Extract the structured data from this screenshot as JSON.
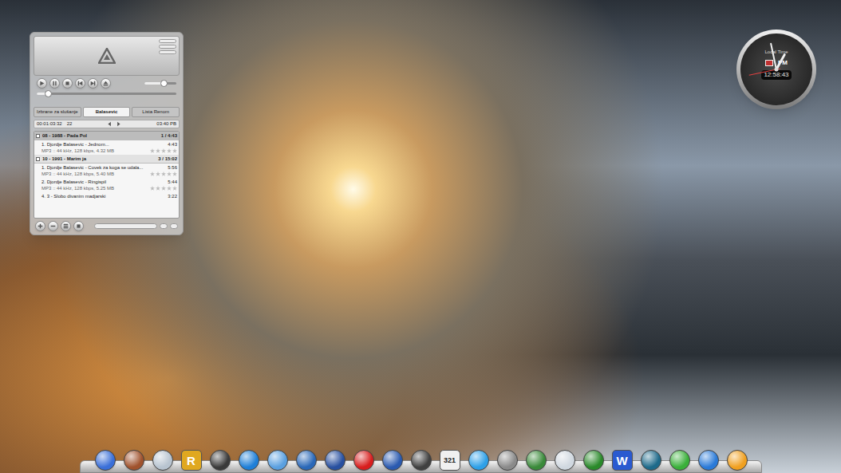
{
  "player": {
    "progress": {
      "level": 0.08
    },
    "volume": {
      "level": 0.6
    },
    "tabs": [
      {
        "label": "Izbrane za slušanje",
        "selected": false
      },
      {
        "label": "Balasevic",
        "selected": true
      },
      {
        "label": "Lista Renom",
        "selected": false
      }
    ],
    "info": {
      "elapsed": "00:01:03:32",
      "count": "22",
      "total": "03:40 PB"
    },
    "playlist": [
      {
        "kind": "group",
        "title": "08 - 1988 - Pada Pol",
        "summary": "1 / 4:43",
        "selected": true
      },
      {
        "kind": "track",
        "title": "1. Djordje Balasevic - Jednom...",
        "duration": "4:43",
        "details": "MP3 :: 44 kHz, 128 kbps, 4.32 MB",
        "stars": 0
      },
      {
        "kind": "group",
        "title": "10 - 1991 - Marim ja",
        "summary": "3 / 15:02",
        "selected": false
      },
      {
        "kind": "track",
        "title": "1. Djordje Balasevic - Covek za koga se udala...",
        "duration": "5:56",
        "details": "MP3 :: 44 kHz, 128 kbps, 5.40 MB",
        "stars": 0
      },
      {
        "kind": "track",
        "title": "2. Djordje Balasevic - Ringispil",
        "duration": "5:44",
        "details": "MP3 :: 44 kHz, 128 kbps, 5.25 MB",
        "stars": 0
      },
      {
        "kind": "track",
        "title": "4. 3 - Slobo divanim madjarski",
        "duration": "3:22"
      }
    ]
  },
  "clock": {
    "label": "Local Time",
    "period": "PM",
    "time": "12:58:43"
  },
  "dock": [
    {
      "kind": "plain",
      "color": "#3a6fd8"
    },
    {
      "kind": "plain",
      "color": "#a0522d"
    },
    {
      "kind": "plain",
      "color": "#b8c4d0"
    },
    {
      "kind": "glyph",
      "glyph": "R",
      "color": "#e0a820"
    },
    {
      "kind": "plain",
      "color": "#3a3a3a"
    },
    {
      "kind": "plain",
      "color": "#1e7fd8"
    },
    {
      "kind": "plain",
      "color": "#5aa0e0"
    },
    {
      "kind": "plain",
      "color": "#2a68b8"
    },
    {
      "kind": "plain",
      "color": "#2850a0"
    },
    {
      "kind": "plain",
      "color": "#d81e1e"
    },
    {
      "kind": "plain",
      "color": "#2a5ab0"
    },
    {
      "kind": "plain",
      "color": "#404040"
    },
    {
      "kind": "glyph",
      "glyph": "321",
      "color": "#f0f0f0"
    },
    {
      "kind": "plain",
      "color": "#2ea0e8"
    },
    {
      "kind": "plain",
      "color": "#8a8a8a"
    },
    {
      "kind": "plain",
      "color": "#3a8a3a"
    },
    {
      "kind": "plain",
      "color": "#d0d8e0"
    },
    {
      "kind": "plain",
      "color": "#2a8a2a"
    },
    {
      "kind": "glyph",
      "glyph": "W",
      "color": "#2a5ad0"
    },
    {
      "kind": "plain",
      "color": "#1e6a8a"
    },
    {
      "kind": "plain",
      "color": "#3ab03a"
    },
    {
      "kind": "plain",
      "color": "#2a7ad8"
    },
    {
      "kind": "plain",
      "color": "#f0a020"
    }
  ]
}
